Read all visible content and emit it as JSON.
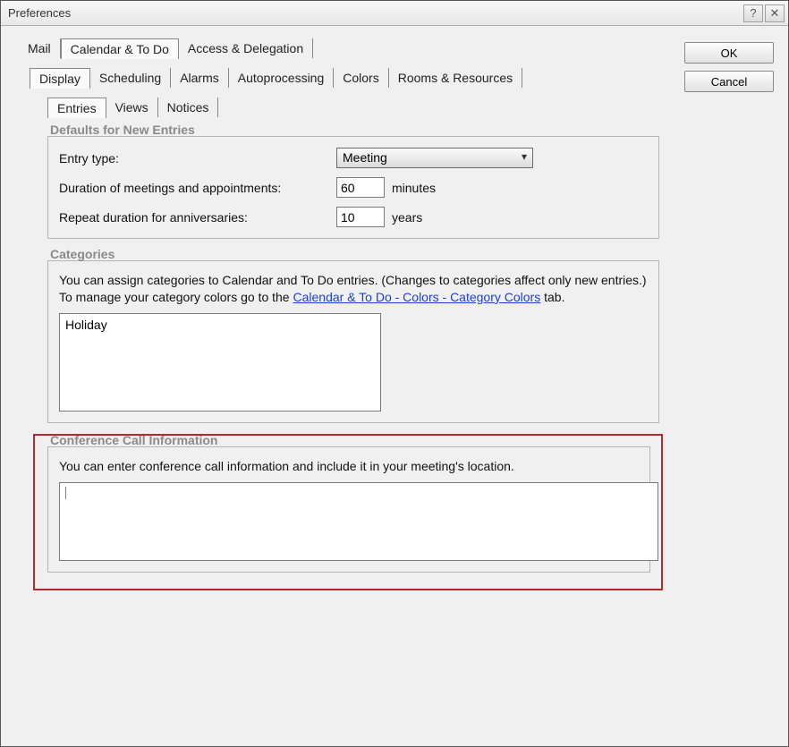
{
  "window": {
    "title": "Preferences",
    "help_glyph": "?",
    "close_glyph": "✕"
  },
  "buttons": {
    "ok": "OK",
    "cancel": "Cancel"
  },
  "tabs_top": {
    "mail": "Mail",
    "calendar": "Calendar & To Do",
    "access": "Access & Delegation"
  },
  "tabs_mid": {
    "display": "Display",
    "scheduling": "Scheduling",
    "alarms": "Alarms",
    "autoprocessing": "Autoprocessing",
    "colors": "Colors",
    "rooms": "Rooms & Resources"
  },
  "tabs_sub": {
    "entries": "Entries",
    "views": "Views",
    "notices": "Notices"
  },
  "defaults": {
    "heading": "Defaults for New Entries",
    "entry_type_label": "Entry type:",
    "entry_type_value": "Meeting",
    "duration_label": "Duration of meetings and appointments:",
    "duration_value": "60",
    "duration_unit": "minutes",
    "repeat_label": "Repeat duration for anniversaries:",
    "repeat_value": "10",
    "repeat_unit": "years"
  },
  "categories": {
    "heading": "Categories",
    "desc_pre": "You can assign categories to Calendar and To Do entries.  (Changes to categories affect only new entries.) To manage your category colors go to the ",
    "link_text": "Calendar & To Do - Colors - Category Colors",
    "desc_post": " tab.",
    "value": "Holiday"
  },
  "conference": {
    "heading": "Conference Call Information",
    "desc": "You can enter conference call information and include it in your meeting's location.",
    "value": ""
  }
}
